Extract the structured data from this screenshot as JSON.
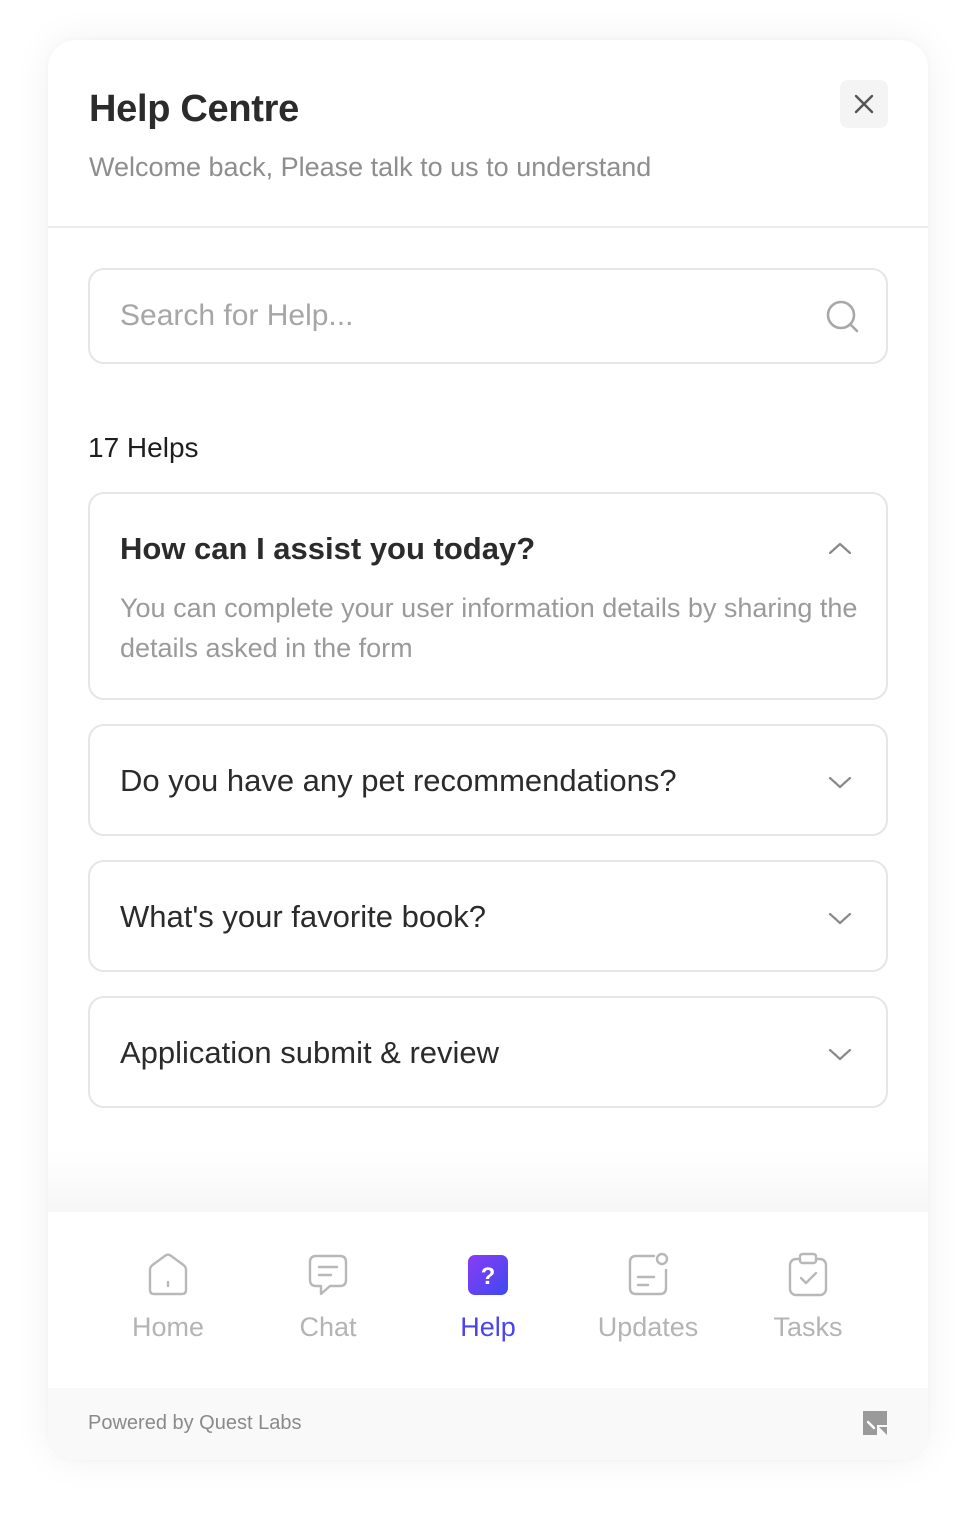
{
  "header": {
    "title": "Help Centre",
    "subtitle": "Welcome back, Please talk to us to understand",
    "close_icon": "close-icon"
  },
  "search": {
    "placeholder": "Search for Help...",
    "value": "",
    "icon": "search-icon"
  },
  "helps": {
    "count_label": "17 Helps",
    "items": [
      {
        "question": "How can I assist you today?",
        "answer": "You can complete your user information details by sharing the details asked in the form",
        "expanded": true,
        "icon": "chevron-up-icon"
      },
      {
        "question": "Do you have any pet recommendations?",
        "expanded": false,
        "icon": "chevron-down-icon"
      },
      {
        "question": "What's your favorite book?",
        "expanded": false,
        "icon": "chevron-down-icon"
      },
      {
        "question": "Application submit & review",
        "expanded": false,
        "icon": "chevron-down-icon"
      }
    ]
  },
  "nav": {
    "items": [
      {
        "label": "Home",
        "icon": "home-icon",
        "active": false
      },
      {
        "label": "Chat",
        "icon": "chat-icon",
        "active": false
      },
      {
        "label": "Help",
        "icon": "help-icon",
        "active": true
      },
      {
        "label": "Updates",
        "icon": "updates-icon",
        "active": false
      },
      {
        "label": "Tasks",
        "icon": "tasks-icon",
        "active": false
      }
    ]
  },
  "footer": {
    "powered_by": "Powered by Quest Labs",
    "logo_icon": "quest-labs-logo-icon"
  },
  "colors": {
    "accent": "#4b42f0",
    "accent_gradient_end": "#8a3cf5",
    "muted_text": "#9a9a9a",
    "border": "#e6e6e6"
  }
}
